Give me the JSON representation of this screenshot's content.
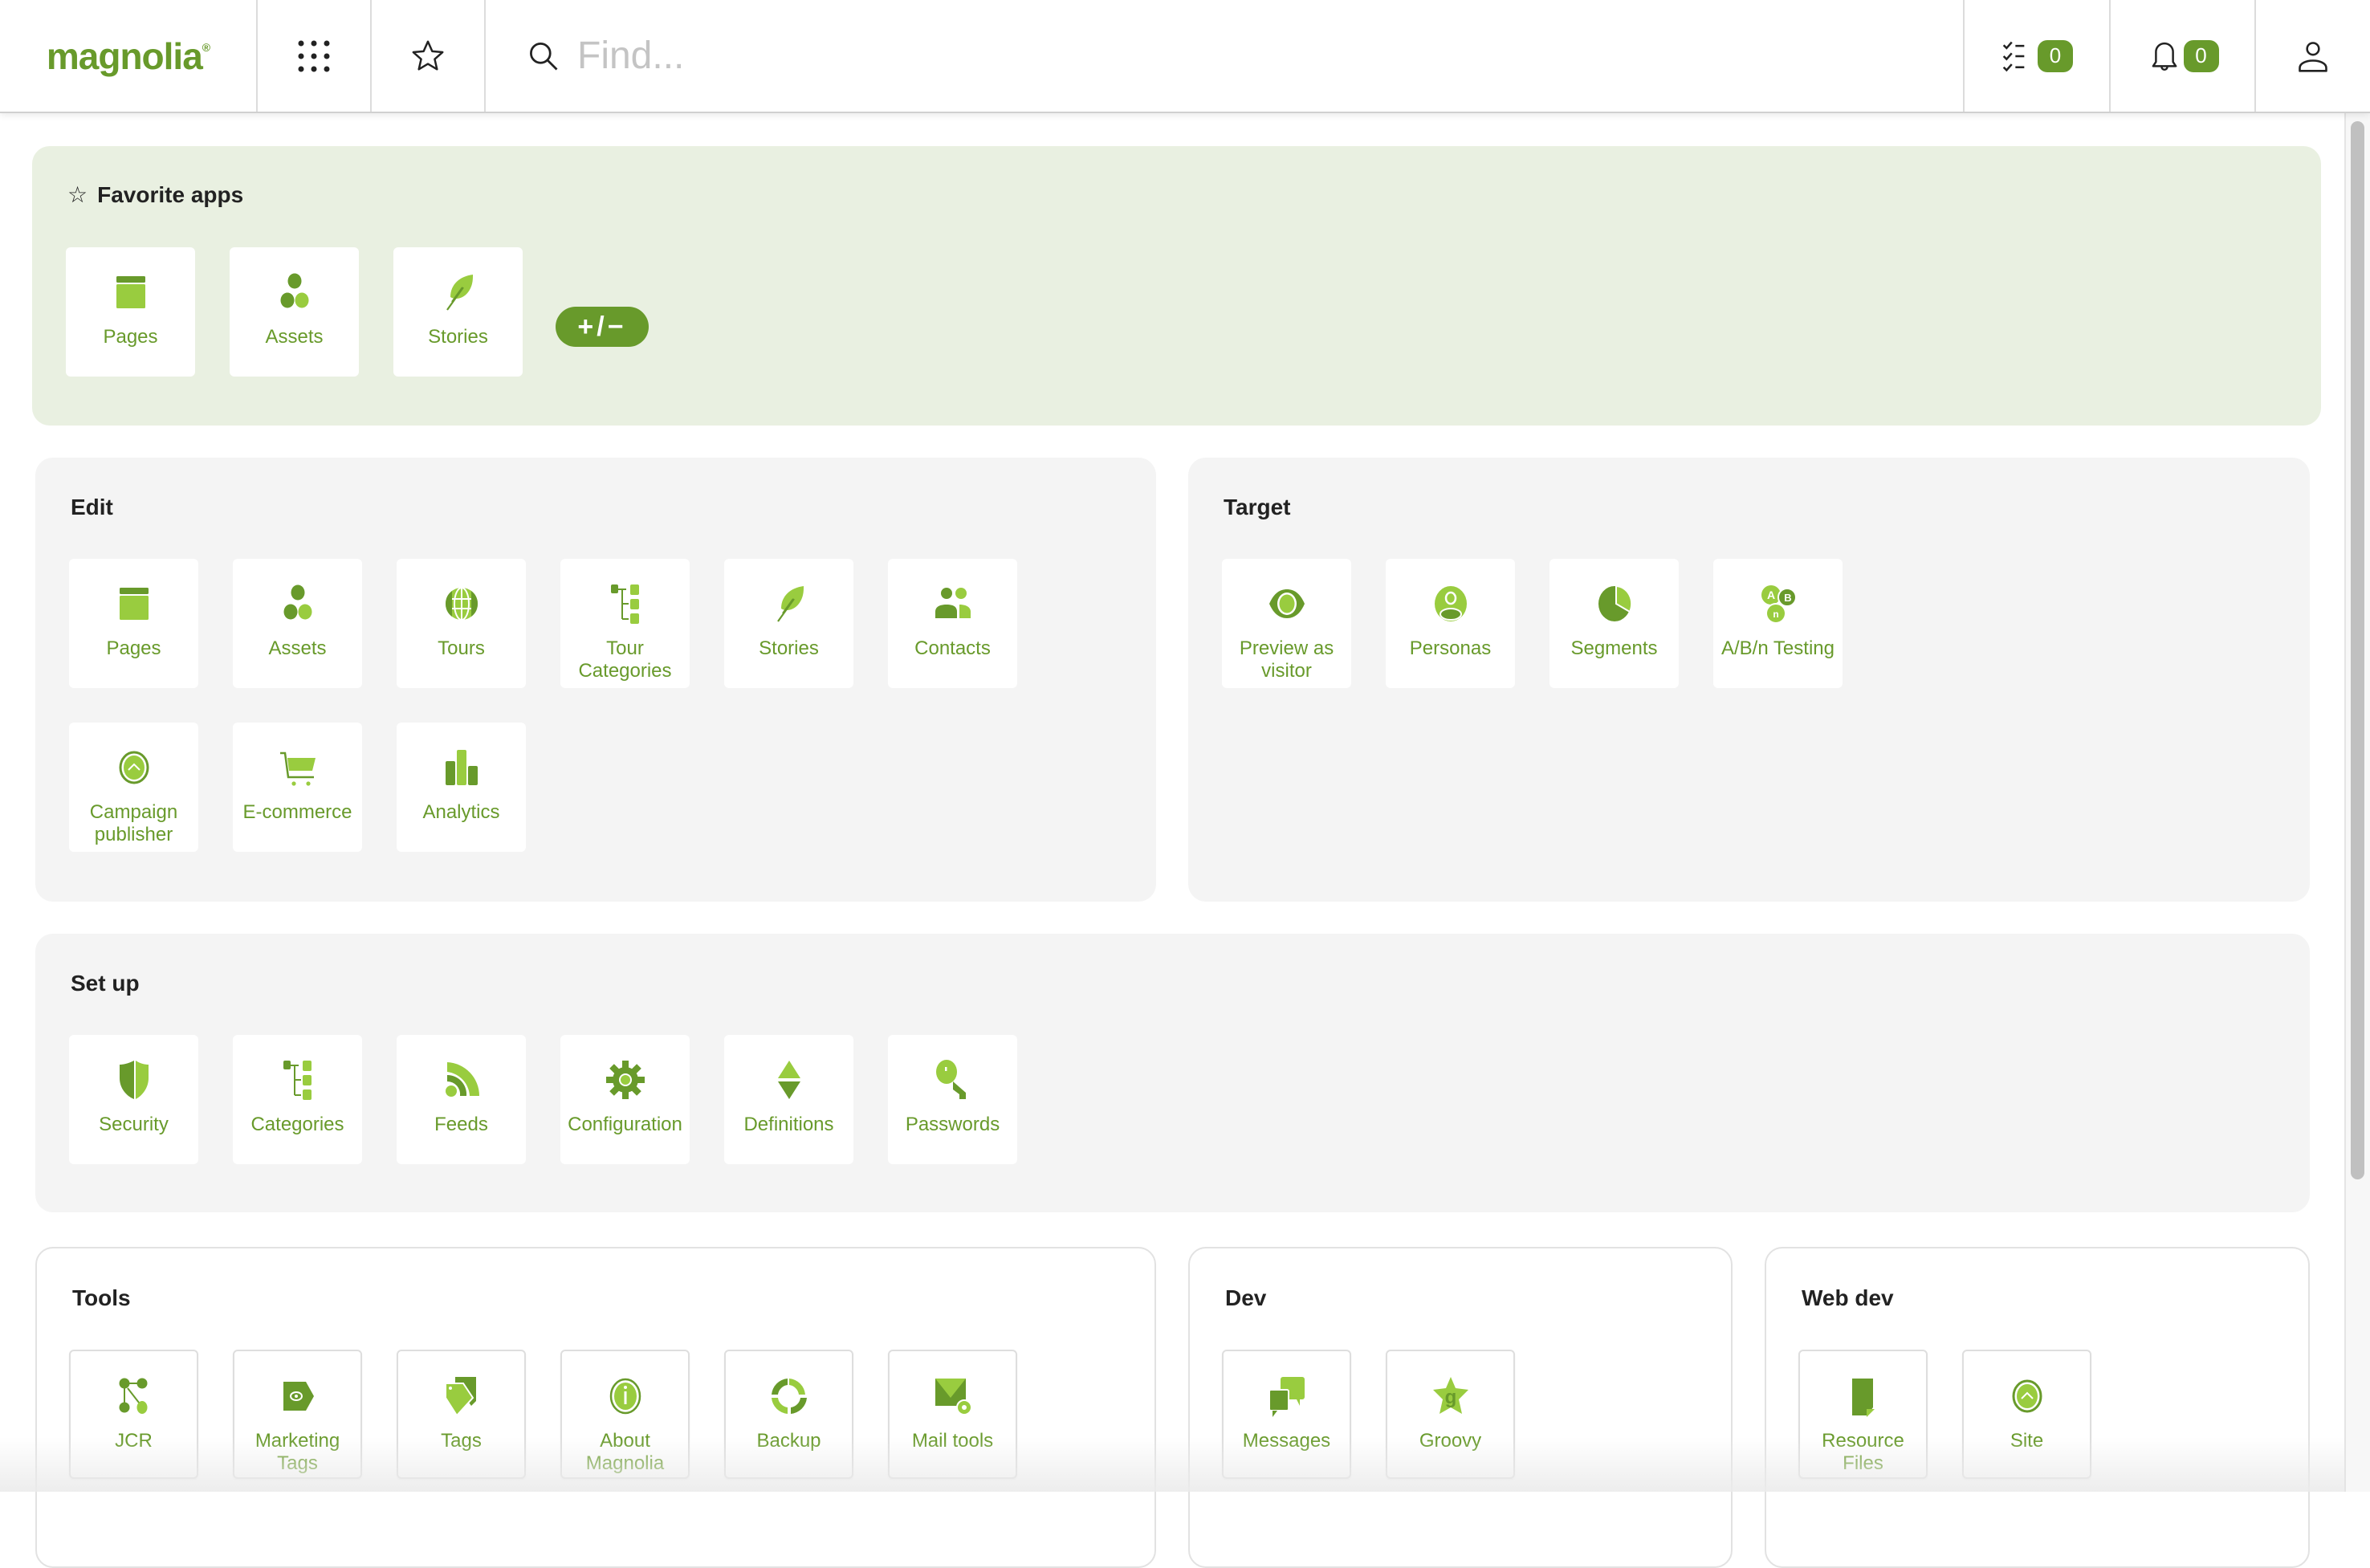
{
  "header": {
    "logo_text": "magnolia",
    "logo_mark": "®",
    "search_placeholder": "Find...",
    "tasks_count": "0",
    "notifications_count": "0",
    "icons": {
      "apps": "grid-dots-icon",
      "favorites": "star-icon",
      "search": "search-icon",
      "tasks": "checklist-icon",
      "notifications": "bell-icon",
      "user": "user-icon"
    }
  },
  "colors": {
    "accent_dark": "#689a2b",
    "accent_light": "#99cc3f",
    "favorites_bg": "#e9f0e1",
    "panel_bg": "#f4f4f4"
  },
  "favorites": {
    "title": "Favorite apps",
    "edit_button": "+/−",
    "apps": [
      {
        "label": "Pages",
        "icon": "pages"
      },
      {
        "label": "Assets",
        "icon": "assets"
      },
      {
        "label": "Stories",
        "icon": "stories"
      }
    ]
  },
  "groups": {
    "edit": {
      "title": "Edit",
      "apps": [
        {
          "label": "Pages",
          "icon": "pages"
        },
        {
          "label": "Assets",
          "icon": "assets"
        },
        {
          "label": "Tours",
          "icon": "globe"
        },
        {
          "label": "Tour Categories",
          "icon": "tree"
        },
        {
          "label": "Stories",
          "icon": "stories"
        },
        {
          "label": "Contacts",
          "icon": "contacts"
        },
        {
          "label": "Campaign publisher",
          "icon": "campaign"
        },
        {
          "label": "E-commerce",
          "icon": "cart"
        },
        {
          "label": "Analytics",
          "icon": "analytics"
        }
      ]
    },
    "target": {
      "title": "Target",
      "apps": [
        {
          "label": "Preview as visitor",
          "icon": "eye"
        },
        {
          "label": "Personas",
          "icon": "persona"
        },
        {
          "label": "Segments",
          "icon": "pie"
        },
        {
          "label": "A/B/n Testing",
          "icon": "abn"
        }
      ]
    },
    "setup": {
      "title": "Set up",
      "apps": [
        {
          "label": "Security",
          "icon": "shield"
        },
        {
          "label": "Categories",
          "icon": "tree"
        },
        {
          "label": "Feeds",
          "icon": "feed"
        },
        {
          "label": "Configuration",
          "icon": "gear"
        },
        {
          "label": "Definitions",
          "icon": "definitions"
        },
        {
          "label": "Passwords",
          "icon": "key"
        }
      ]
    },
    "tools": {
      "title": "Tools",
      "apps": [
        {
          "label": "JCR",
          "icon": "jcr"
        },
        {
          "label": "Marketing Tags",
          "icon": "marketing-tag"
        },
        {
          "label": "Tags",
          "icon": "tags"
        },
        {
          "label": "About Magnolia",
          "icon": "info"
        },
        {
          "label": "Backup",
          "icon": "backup"
        },
        {
          "label": "Mail tools",
          "icon": "mail"
        }
      ]
    },
    "dev": {
      "title": "Dev",
      "apps": [
        {
          "label": "Messages",
          "icon": "messages"
        },
        {
          "label": "Groovy",
          "icon": "groovy"
        }
      ]
    },
    "webdev": {
      "title": "Web dev",
      "apps": [
        {
          "label": "Resource Files",
          "icon": "resource"
        },
        {
          "label": "Site",
          "icon": "site"
        }
      ]
    }
  }
}
